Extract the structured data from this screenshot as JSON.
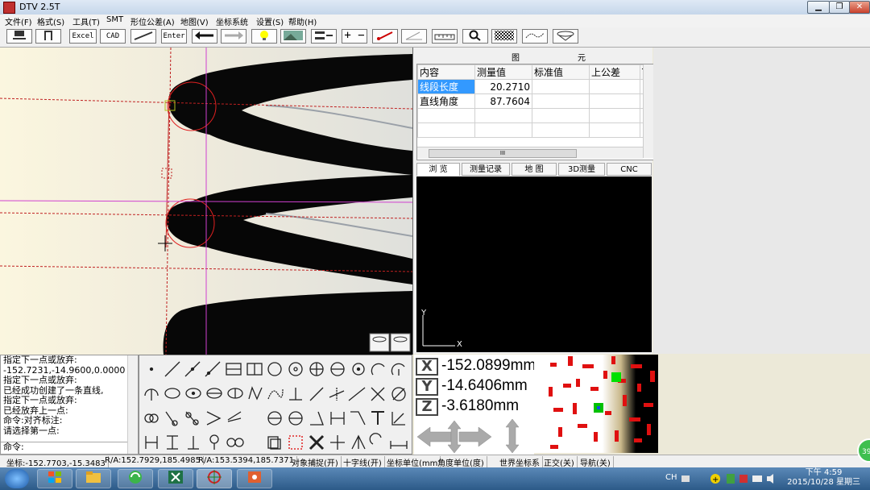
{
  "window": {
    "title": "DTV 2.5T",
    "minimize": "▁",
    "maximize": "❐",
    "close": "✕"
  },
  "menu": [
    "文件(F)",
    "格式(S)",
    "工具(T)",
    "SMT",
    "形位公差(A)",
    "地图(V)",
    "坐标系统",
    "设置(S)",
    "帮助(H)"
  ],
  "toolbar": {
    "excel": "Excel",
    "cad": "CAD",
    "enter": "Enter"
  },
  "panel": {
    "title_left": "图",
    "title_right": "元",
    "columns": [
      "内容",
      "测量值",
      "标准值",
      "上公差",
      "T"
    ],
    "rows": [
      {
        "name": "线段长度",
        "value": "20.2710"
      },
      {
        "name": "直线角度",
        "value": "87.7604"
      }
    ],
    "scroll_mark": "III"
  },
  "tabs": [
    "浏 览",
    "测量记录",
    "地 图",
    "3D测量",
    "CNC"
  ],
  "preview": {
    "y_label": "Y",
    "x_label": "X"
  },
  "command_log": [
    "指定下一点或放弃:",
    "-152.7231,-14.9600,0.0000",
    "指定下一点或放弃:",
    "已经成功创建了一条直线,",
    "指定下一点或放弃:",
    "已经放弃上一点:",
    "命令:对齐标注:",
    "请选择第一点:",
    "",
    "命令:"
  ],
  "coords": {
    "x_label": "X",
    "y_label": "Y",
    "z_label": "Z",
    "x": "-152.0899mm",
    "y": "-14.6406mm",
    "z": "-3.6180mm"
  },
  "status": [
    "坐标:-152.7703,-15.3483",
    "R/A:152.7929,185.4985",
    "R/A:153.5394,185.7371",
    "对象捕捉(开)",
    "十字线(开)",
    "坐标单位(mm",
    "角度单位(度)",
    "世界坐标系",
    "正交(关)",
    "导航(关)"
  ],
  "taskbar": {
    "lang": "CH",
    "time": "下午 4:59",
    "date": "2015/10/28 星期三",
    "badge": "39"
  }
}
